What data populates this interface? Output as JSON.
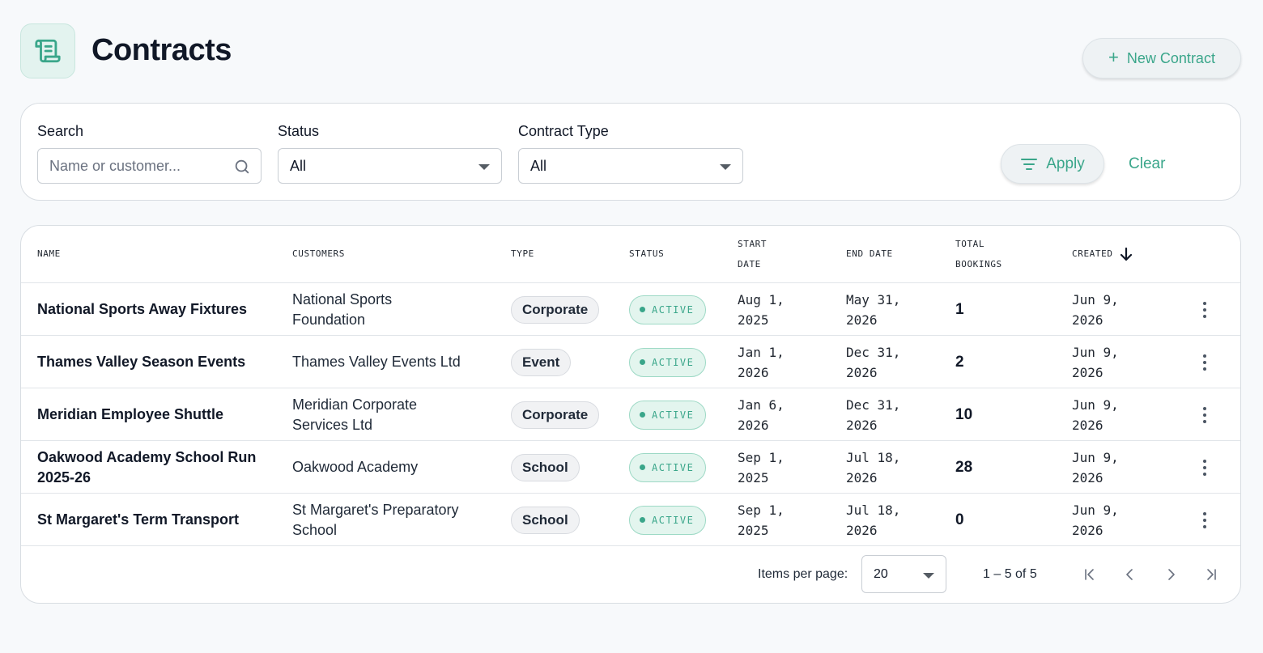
{
  "header": {
    "title": "Contracts",
    "logo_icon": "scroll-icon",
    "new_button_label": "New Contract"
  },
  "filters": {
    "search_label": "Search",
    "search_placeholder": "Name or customer...",
    "status_label": "Status",
    "status_value": "All",
    "type_label": "Contract Type",
    "type_value": "All",
    "apply_label": "Apply",
    "clear_label": "Clear"
  },
  "table": {
    "columns": {
      "name": "NAME",
      "customers": "CUSTOMERS",
      "type": "TYPE",
      "status": "STATUS",
      "start_date_1": "START",
      "start_date_2": "DATE",
      "end_date": "END DATE",
      "total_bookings_1": "TOTAL",
      "total_bookings_2": "BOOKINGS",
      "created": "CREATED"
    },
    "rows": [
      {
        "name_1": "National Sports Away Fixtures",
        "name_2": "",
        "customer_1": "National Sports",
        "customer_2": "Foundation",
        "type": "Corporate",
        "status": "ACTIVE",
        "start_1": "Aug 1,",
        "start_2": "2025",
        "end_1": "May 31,",
        "end_2": "2026",
        "bookings": "1",
        "created_1": "Jun 9,",
        "created_2": "2026"
      },
      {
        "name_1": "Thames Valley Season Events",
        "name_2": "",
        "customer_1": "Thames Valley Events Ltd",
        "customer_2": "",
        "type": "Event",
        "status": "ACTIVE",
        "start_1": "Jan 1,",
        "start_2": "2026",
        "end_1": "Dec 31,",
        "end_2": "2026",
        "bookings": "2",
        "created_1": "Jun 9,",
        "created_2": "2026"
      },
      {
        "name_1": "Meridian Employee Shuttle",
        "name_2": "",
        "customer_1": "Meridian Corporate",
        "customer_2": "Services Ltd",
        "type": "Corporate",
        "status": "ACTIVE",
        "start_1": "Jan 6,",
        "start_2": "2026",
        "end_1": "Dec 31,",
        "end_2": "2026",
        "bookings": "10",
        "created_1": "Jun 9,",
        "created_2": "2026"
      },
      {
        "name_1": "Oakwood Academy School Run",
        "name_2": "2025-26",
        "customer_1": "Oakwood Academy",
        "customer_2": "",
        "type": "School",
        "status": "ACTIVE",
        "start_1": "Sep 1,",
        "start_2": "2025",
        "end_1": "Jul 18,",
        "end_2": "2026",
        "bookings": "28",
        "created_1": "Jun 9,",
        "created_2": "2026"
      },
      {
        "name_1": "St Margaret's Term Transport",
        "name_2": "",
        "customer_1": "St Margaret's Preparatory",
        "customer_2": "School",
        "type": "School",
        "status": "ACTIVE",
        "start_1": "Sep 1,",
        "start_2": "2025",
        "end_1": "Jul 18,",
        "end_2": "2026",
        "bookings": "0",
        "created_1": "Jun 9,",
        "created_2": "2026"
      }
    ]
  },
  "pagination": {
    "items_per_page_label": "Items per page:",
    "items_per_page_value": "20",
    "range_text": "1 – 5 of 5"
  },
  "colors": {
    "accent": "#3aa68a",
    "background": "#f7f9fb",
    "active_bg": "#e3f5ee"
  }
}
